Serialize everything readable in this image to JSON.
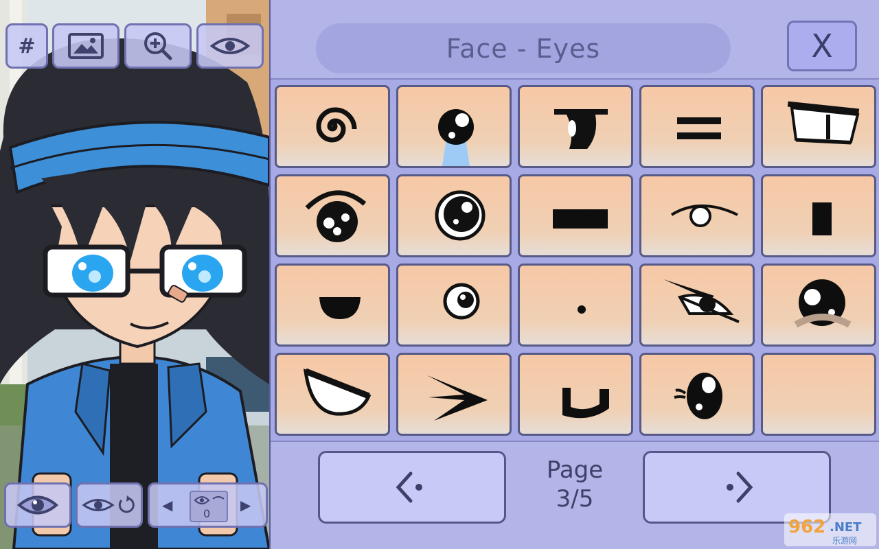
{
  "toolbar": {
    "grid_label": "#",
    "buttons": [
      "grid-button",
      "background-image-button",
      "zoom-button",
      "visibility-button"
    ]
  },
  "bottom_controls": {
    "pose_value": "0"
  },
  "header": {
    "title": "Face - Eyes",
    "close_label": "X"
  },
  "eye_options": [
    {
      "row": 1,
      "icons": [
        "spiral-eye-icon",
        "teary-eye-icon",
        "half-shut-eye-icon",
        "equal-lines-eye-icon",
        "side-glance-eye-icon"
      ]
    },
    {
      "row": 2,
      "icons": [
        "sparkle-eye-icon",
        "shiny-round-eye-icon",
        "flat-bar-eye-icon",
        "sleepy-eye-icon",
        "vertical-bar-eye-icon"
      ]
    },
    {
      "row": 3,
      "icons": [
        "semicircle-eye-icon",
        "small-round-eye-icon",
        "dot-eye-icon",
        "angry-eye-icon",
        "sad-round-eye-icon"
      ]
    },
    {
      "row": 4,
      "icons": [
        "happy-closed-eye-icon",
        "arrow-eye-icon",
        "u-shaped-eye-icon",
        "lashed-eye-icon",
        "empty-slot"
      ]
    }
  ],
  "pagination": {
    "label": "Page",
    "current": "3/5",
    "prev_icon": "chevron-left-icon",
    "next_icon": "chevron-right-icon"
  },
  "watermark": {
    "brand": "962",
    "suffix": ".NET",
    "subtitle": "乐游网"
  },
  "colors": {
    "panel_bg": "#b3b5e8",
    "cell_bg": "#f6c8a6",
    "border": "#575a86",
    "title_text": "#5b5d8f"
  }
}
